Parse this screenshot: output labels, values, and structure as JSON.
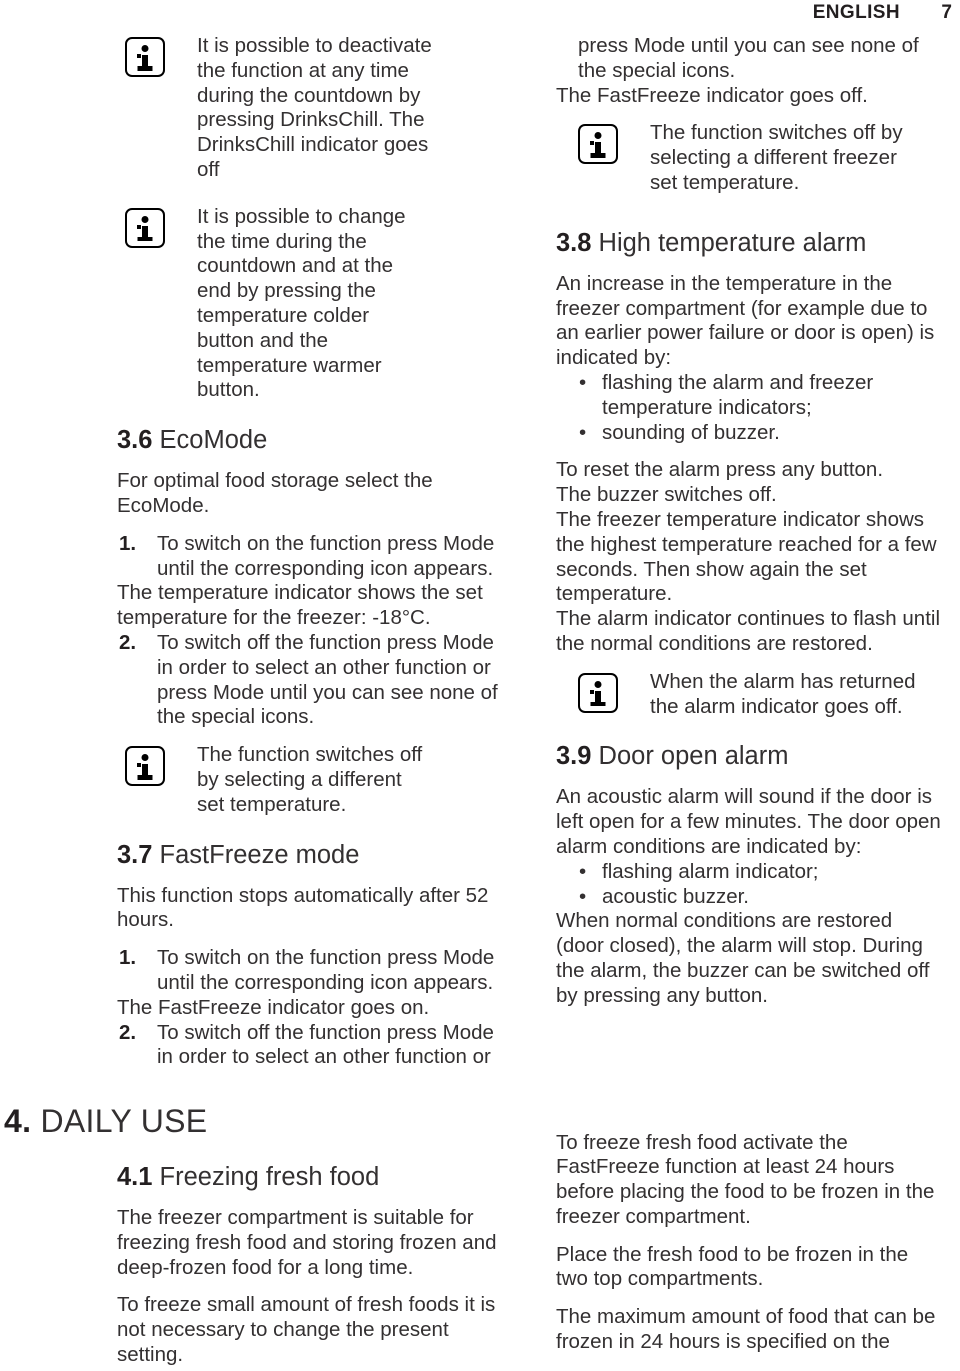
{
  "header": {
    "language": "ENGLISH",
    "page_number": "7"
  },
  "icons": {
    "info": "info-icon",
    "bullet": "•"
  },
  "left_column": {
    "note_drinkschill": {
      "icon": "info-icon",
      "lines": [
        "It is possible to deactivate",
        "the function at any time",
        "during the countdown by",
        "pressing DrinksChill. The",
        "DrinksChill indicator goes",
        "off"
      ]
    },
    "note_change_time": {
      "icon": "info-icon",
      "lines": [
        "It is possible to change",
        "the time during the",
        "countdown and at the",
        "end by pressing the",
        "temperature colder",
        "button and the",
        "temperature warmer",
        "button."
      ]
    },
    "section_3_6": {
      "number": "3.6",
      "title": "EcoMode",
      "intro_lines": [
        "For optimal food storage select the",
        "EcoMode."
      ],
      "steps": [
        {
          "marker": "1.",
          "lines": [
            "To switch on the function press Mode",
            "until the corresponding icon appears."
          ]
        },
        {
          "marker": "2.",
          "lines": [
            "To switch off the function press Mode",
            "in order to select an other function or",
            "press Mode until you can see none of",
            "the special icons."
          ]
        }
      ],
      "after_step1_lines": [
        "The temperature indicator shows the set",
        "temperature for the freezer: -18°C."
      ],
      "note": {
        "icon": "info-icon",
        "lines": [
          "The function switches off",
          "by selecting a different",
          "set temperature."
        ]
      }
    },
    "section_3_7": {
      "number": "3.7",
      "title": "FastFreeze mode",
      "intro_lines": [
        "This function stops automatically after 52",
        "hours."
      ],
      "steps": [
        {
          "marker": "1.",
          "lines": [
            "To switch on the function press Mode",
            "until the corresponding icon appears."
          ]
        },
        {
          "marker": "2.",
          "lines": [
            "To switch off the function press Mode",
            "in order to select an other function or"
          ]
        }
      ],
      "after_step1_lines": [
        "The FastFreeze indicator goes on."
      ]
    },
    "section_4": {
      "number": "4.",
      "title": "DAILY USE"
    },
    "section_4_1": {
      "number": "4.1",
      "title": "Freezing fresh food",
      "paragraph_1_lines": [
        "The freezer compartment is suitable for",
        "freezing fresh food and storing frozen and",
        "deep-frozen food for a long time."
      ],
      "paragraph_2_lines": [
        "To freeze small amount of fresh foods it is",
        "not necessary to change the present",
        "setting."
      ]
    }
  },
  "right_column": {
    "continuation_lines_indented": [
      "press Mode until you can see none of",
      "the special icons."
    ],
    "continuation_line_flush": "The FastFreeze indicator goes off.",
    "note_fastfreeze": {
      "icon": "info-icon",
      "lines": [
        "The function switches off by",
        "selecting a different freezer",
        "set temperature."
      ]
    },
    "section_3_8": {
      "number": "3.8",
      "title": "High temperature alarm",
      "paragraph_1_lines": [
        "An increase in the temperature in the",
        "freezer compartment (for example due to",
        "an earlier power failure or door is open) is",
        "indicated by:"
      ],
      "bullets": [
        {
          "lines": [
            "flashing the alarm and freezer",
            "temperature indicators;"
          ]
        },
        {
          "lines": [
            "sounding of buzzer."
          ]
        }
      ],
      "paragraph_2_lines": [
        "To reset the alarm press any button.",
        "The buzzer switches off.",
        "The freezer temperature indicator shows",
        "the highest temperature reached for a few",
        "seconds. Then show again the set",
        "temperature.",
        "The alarm indicator continues to flash until",
        "the normal conditions are restored."
      ],
      "note": {
        "icon": "info-icon",
        "lines": [
          "When the alarm has returned",
          "the alarm indicator goes off."
        ]
      }
    },
    "section_3_9": {
      "number": "3.9",
      "title": "Door open alarm",
      "paragraph_1_lines": [
        "An acoustic alarm will sound if the door is",
        "left open for a few minutes. The door open",
        "alarm conditions are indicated by:"
      ],
      "bullets": [
        {
          "lines": [
            "flashing alarm indicator;"
          ]
        },
        {
          "lines": [
            "acoustic buzzer."
          ]
        }
      ],
      "paragraph_2_lines": [
        "When normal conditions are restored",
        "(door closed), the alarm will stop. During",
        "the alarm, the buzzer can be switched off",
        "by pressing any button."
      ]
    },
    "bottom": {
      "paragraph_1_lines": [
        "To freeze fresh food activate the",
        "FastFreeze function at least 24 hours",
        "before placing the food to be frozen in the",
        "freezer compartment."
      ],
      "paragraph_2_lines": [
        "Place the fresh food to be frozen in the",
        "two top compartments."
      ],
      "paragraph_3_lines": [
        "The maximum amount of food that can be",
        "frozen in 24 hours is specified on the"
      ]
    }
  }
}
